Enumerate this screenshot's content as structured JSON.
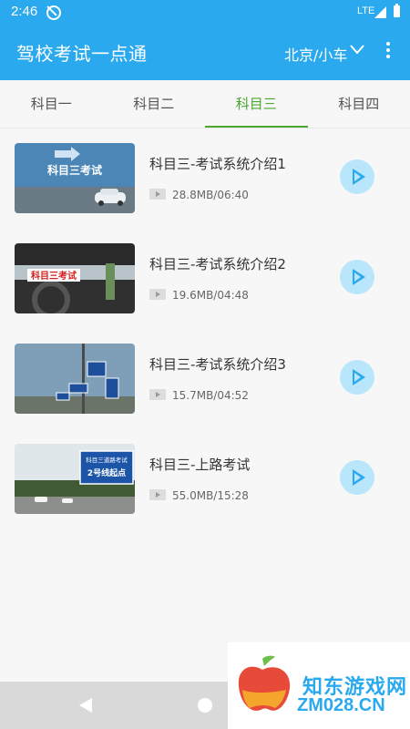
{
  "status_bar": {
    "time": "2:46",
    "network": "LTE"
  },
  "app_bar": {
    "title": "驾校考试一点通",
    "city_selector": "北京/小车"
  },
  "tabs": [
    {
      "label": "科目一",
      "active": false
    },
    {
      "label": "科目二",
      "active": false
    },
    {
      "label": "科目三",
      "active": true
    },
    {
      "label": "科目四",
      "active": false
    }
  ],
  "videos": [
    {
      "title": "科目三-考试系统介绍1",
      "meta": "28.8MB/06:40",
      "thumb_text": "科目三考试"
    },
    {
      "title": "科目三-考试系统介绍2",
      "meta": "19.6MB/04:48",
      "thumb_text": "科目三考试"
    },
    {
      "title": "科目三-考试系统介绍3",
      "meta": "15.7MB/04:52",
      "thumb_text": ""
    },
    {
      "title": "科目三-上路考试",
      "meta": "55.0MB/15:28",
      "thumb_text": "科目三道路考试",
      "thumb_text2": "2号线起点"
    }
  ],
  "watermark": {
    "line1": "知东游戏网",
    "line2": "ZM028.CN"
  },
  "colors": {
    "primary": "#2aa9ee",
    "active_tab": "#4aa82f",
    "play_bg": "#b9e6fb"
  }
}
